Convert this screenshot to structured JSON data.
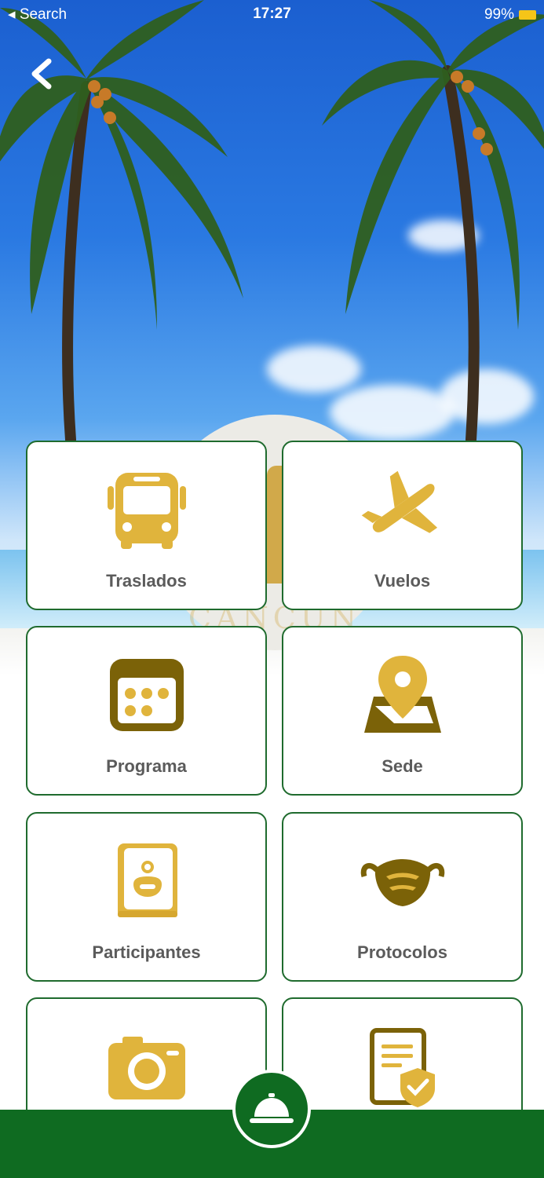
{
  "status_bar": {
    "back_label": "◂ Search",
    "time": "17:27",
    "battery_text": "99%"
  },
  "scene": {
    "logo_text": "CANCUN"
  },
  "menu": {
    "items": [
      {
        "label": "Traslados",
        "icon": "bus-icon"
      },
      {
        "label": "Vuelos",
        "icon": "airplane-icon"
      },
      {
        "label": "Programa",
        "icon": "calendar-icon"
      },
      {
        "label": "Sede",
        "icon": "map-pin-icon"
      },
      {
        "label": "Participantes",
        "icon": "contact-book-icon"
      },
      {
        "label": "Protocolos",
        "icon": "face-mask-icon"
      },
      {
        "label": "",
        "icon": "camera-icon"
      },
      {
        "label": "",
        "icon": "document-shield-icon"
      }
    ]
  },
  "colors": {
    "accent_gold": "#e0b43c",
    "dark_gold": "#7b6208",
    "brand_green": "#0f6b21"
  }
}
